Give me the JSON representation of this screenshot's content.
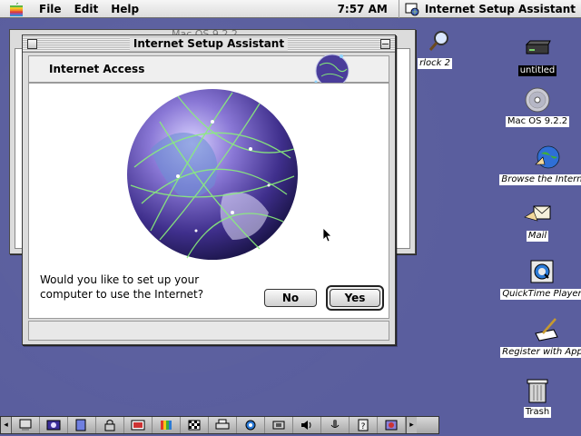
{
  "menubar": {
    "apple_icon": "apple-icon",
    "menus": [
      "File",
      "Edit",
      "Help"
    ],
    "clock": "7:57 AM",
    "active_app": "Internet Setup Assistant",
    "active_app_icon": "internet-setup-icon"
  },
  "background_window": {
    "partial_title": "Mac OS 9.2.2"
  },
  "window": {
    "title": "Internet Setup Assistant",
    "section_title": "Internet Access",
    "question": "Would you like to set up your computer to use the Internet?",
    "no_label": "No",
    "yes_label": "Yes",
    "colors": {
      "chrome": "#dcdcdc",
      "content": "#ffffff",
      "desktop": "#5a5e9e"
    }
  },
  "desktop_icons": [
    {
      "label": "rlock 2",
      "icon": "sherlock-icon"
    },
    {
      "label": "untitled",
      "icon": "hard-disk-icon",
      "selected": true
    },
    {
      "label": "Mac OS 9.2.2",
      "icon": "cd-icon"
    },
    {
      "label": "Browse the Internet",
      "icon": "browser-globe-icon"
    },
    {
      "label": "Mail",
      "icon": "mail-icon"
    },
    {
      "label": "QuickTime Player",
      "icon": "quicktime-icon"
    },
    {
      "label": "Register with Apple",
      "icon": "register-icon"
    },
    {
      "label": "Trash",
      "icon": "trash-icon"
    }
  ],
  "control_strip": {
    "items": [
      "computer-icon",
      "appletalk-icon",
      "file-sharing-icon",
      "keychain-icon",
      "location-icon",
      "monitor-bit-depth-icon",
      "monitor-resolution-icon",
      "printer-icon",
      "quicktime-icon",
      "remote-access-icon",
      "sound-volume-icon",
      "speech-icon",
      "web-sharing-icon",
      "energy-saver-icon"
    ]
  }
}
